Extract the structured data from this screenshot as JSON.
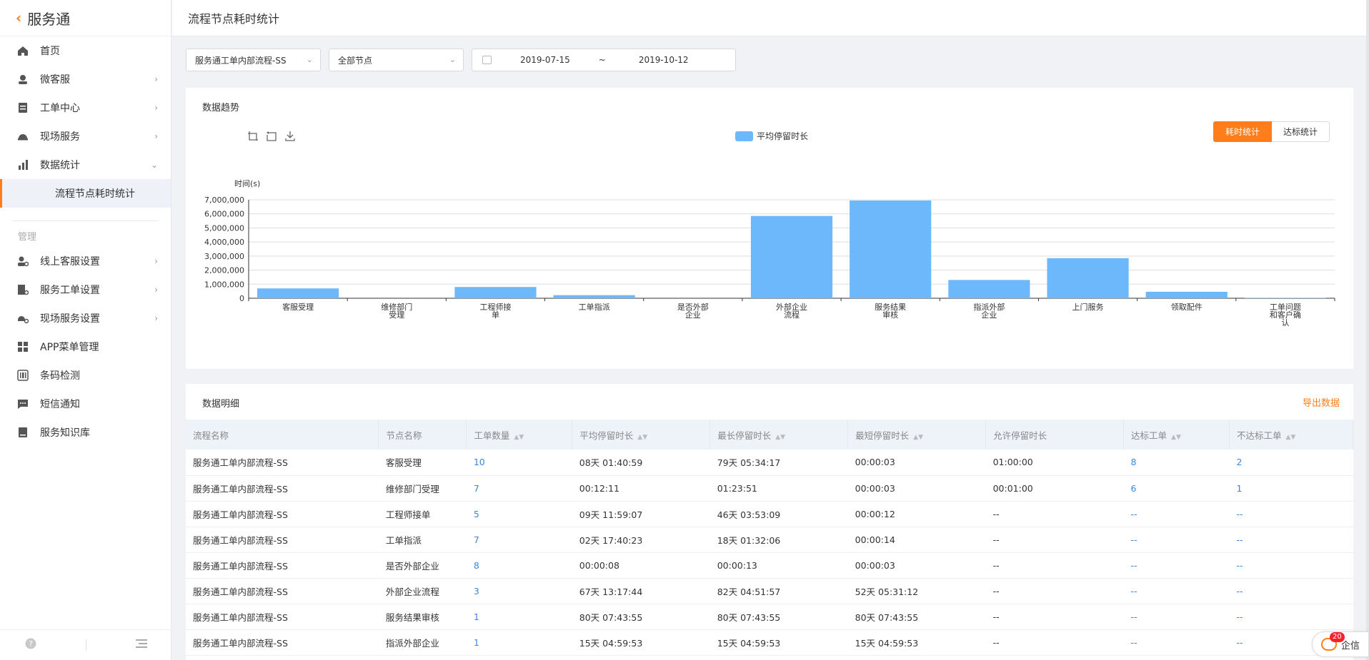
{
  "app": {
    "name": "服务通"
  },
  "header": {
    "title": "流程节点耗时统计"
  },
  "sidebar": {
    "items": [
      {
        "label": "首页",
        "icon": "home-icon",
        "arrow": ""
      },
      {
        "label": "微客服",
        "icon": "customer-service-icon",
        "arrow": "›"
      },
      {
        "label": "工单中心",
        "icon": "ticket-icon",
        "arrow": "›"
      },
      {
        "label": "现场服务",
        "icon": "helmet-icon",
        "arrow": "›"
      },
      {
        "label": "数据统计",
        "icon": "bar-chart-icon",
        "arrow": "⌄"
      }
    ],
    "active_sub": "流程节点耗时统计",
    "group_label": "管理",
    "manage_items": [
      {
        "label": "线上客服设置",
        "icon": "user-gear-icon",
        "arrow": "›"
      },
      {
        "label": "服务工单设置",
        "icon": "doc-gear-icon",
        "arrow": "›"
      },
      {
        "label": "现场服务设置",
        "icon": "site-gear-icon",
        "arrow": "›"
      },
      {
        "label": "APP菜单管理",
        "icon": "grid-icon",
        "arrow": ""
      },
      {
        "label": "条码检测",
        "icon": "barcode-icon",
        "arrow": ""
      },
      {
        "label": "短信通知",
        "icon": "sms-icon",
        "arrow": ""
      },
      {
        "label": "服务知识库",
        "icon": "book-icon",
        "arrow": ""
      }
    ]
  },
  "filters": {
    "process": "服务通工单内部流程-SS",
    "node": "全部节点",
    "date_start": "2019-07-15",
    "date_sep": "~",
    "date_end": "2019-10-12"
  },
  "trend": {
    "title": "数据趋势",
    "legend": "平均停留时长",
    "toggle_active": "耗时统计",
    "toggle_idle": "达标统计"
  },
  "chart_data": {
    "type": "bar",
    "ylabel": "时间(s)",
    "ylim": [
      0,
      7000000
    ],
    "yticks": [
      "0",
      "1,000,000",
      "2,000,000",
      "3,000,000",
      "4,000,000",
      "5,000,000",
      "6,000,000",
      "7,000,000"
    ],
    "categories": [
      "客服受理",
      "维修部门\n受理",
      "工程师接\n单",
      "工单指派",
      "是否外部\n企业",
      "外部企业\n流程",
      "服务结果\n审核",
      "指派外部\n企业",
      "上门服务",
      "领取配件",
      "工单问题\n和客户确\n认"
    ],
    "series": [
      {
        "name": "平均停留时长",
        "color": "#6cb8fb",
        "values": [
          700000,
          0,
          800000,
          220000,
          0,
          5850000,
          6950000,
          1300000,
          2850000,
          460000,
          30000
        ]
      }
    ]
  },
  "detail": {
    "title": "数据明细",
    "export_label": "导出数据",
    "columns": [
      "流程名称",
      "节点名称",
      "工单数量",
      "平均停留时长",
      "最长停留时长",
      "最短停留时长",
      "允许停留时长",
      "达标工单",
      "不达标工单"
    ],
    "rows": [
      [
        "服务通工单内部流程-SS",
        "客服受理",
        "10",
        "08天 01:40:59",
        "79天 05:34:17",
        "00:00:03",
        "01:00:00",
        "8",
        "2"
      ],
      [
        "服务通工单内部流程-SS",
        "维修部门受理",
        "7",
        "00:12:11",
        "01:23:51",
        "00:00:03",
        "00:01:00",
        "6",
        "1"
      ],
      [
        "服务通工单内部流程-SS",
        "工程师接单",
        "5",
        "09天 11:59:07",
        "46天 03:53:09",
        "00:00:12",
        "--",
        "--",
        "--"
      ],
      [
        "服务通工单内部流程-SS",
        "工单指派",
        "7",
        "02天 17:40:23",
        "18天 01:32:06",
        "00:00:14",
        "--",
        "--",
        "--"
      ],
      [
        "服务通工单内部流程-SS",
        "是否外部企业",
        "8",
        "00:00:08",
        "00:00:13",
        "00:00:03",
        "--",
        "--",
        "--"
      ],
      [
        "服务通工单内部流程-SS",
        "外部企业流程",
        "3",
        "67天 13:17:44",
        "82天 04:51:57",
        "52天 05:31:12",
        "--",
        "--",
        "--"
      ],
      [
        "服务通工单内部流程-SS",
        "服务结果审核",
        "1",
        "80天 07:43:55",
        "80天 07:43:55",
        "80天 07:43:55",
        "--",
        "--",
        "--"
      ],
      [
        "服务通工单内部流程-SS",
        "指派外部企业",
        "1",
        "15天 04:59:53",
        "15天 04:59:53",
        "15天 04:59:53",
        "--",
        "--",
        "--"
      ]
    ]
  },
  "qixin": {
    "label": "企信",
    "badge": "20"
  }
}
